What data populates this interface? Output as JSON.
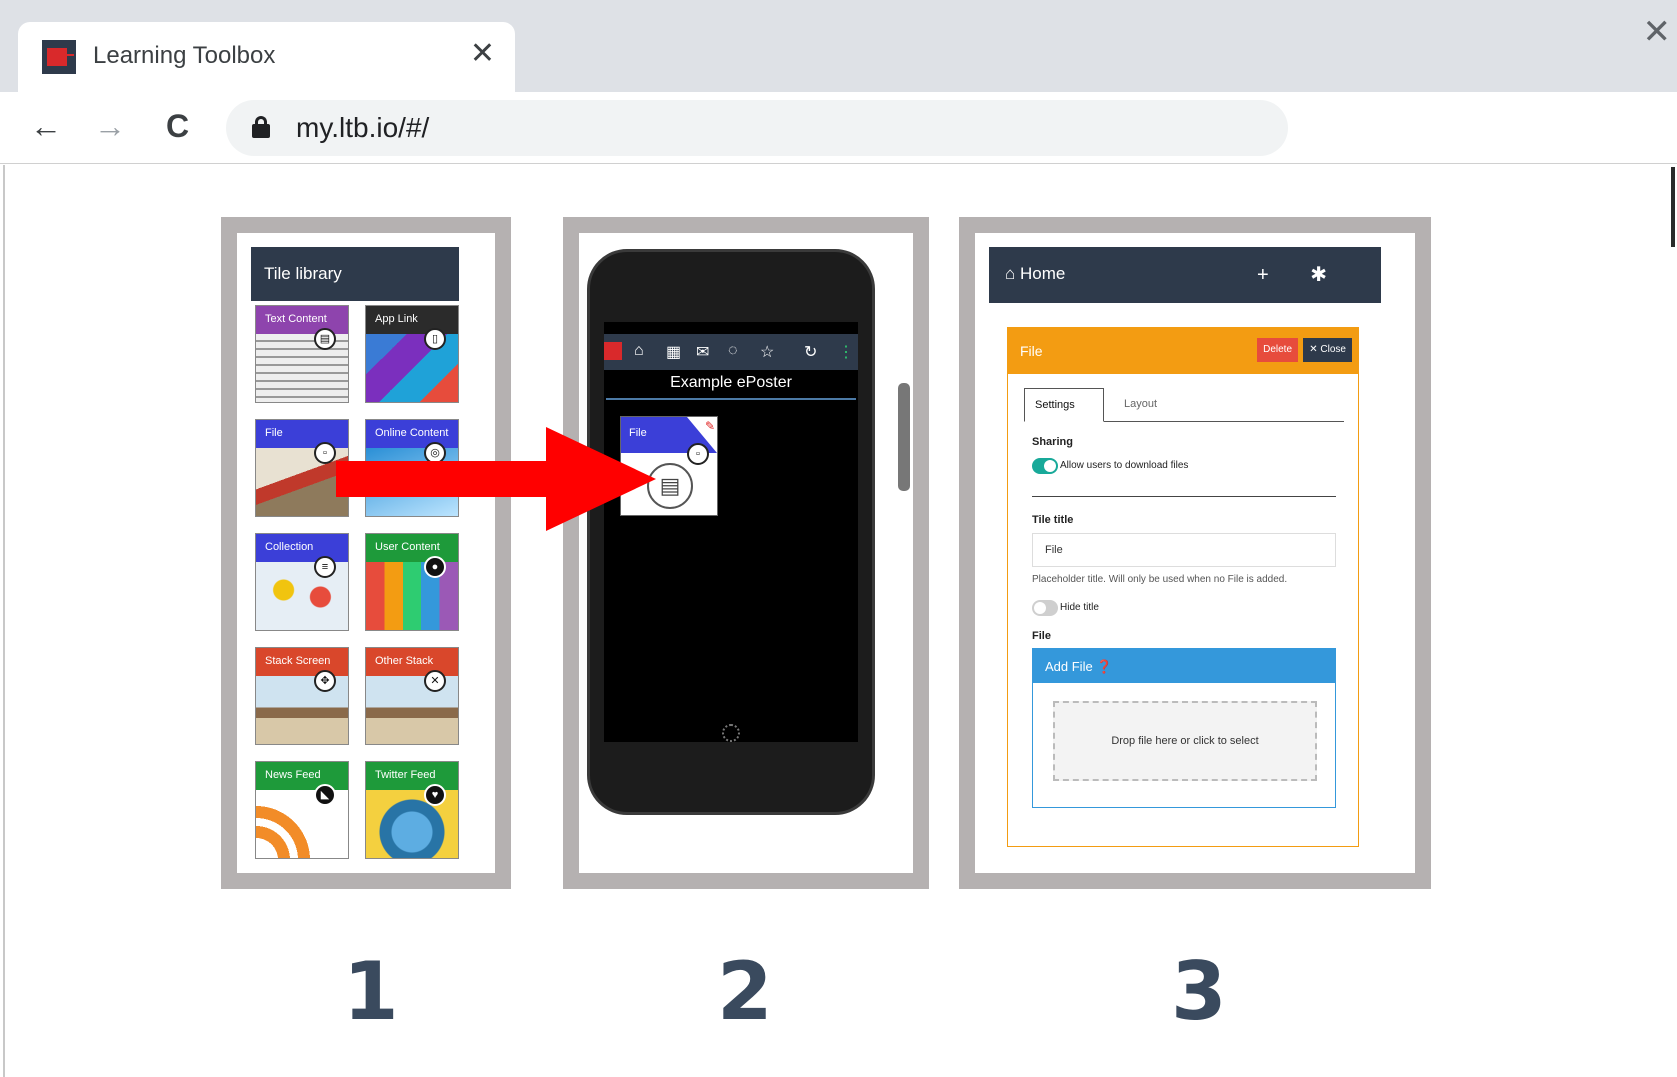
{
  "browser": {
    "tab_title": "Learning Toolbox",
    "tab_close": "✕",
    "window_close": "✕",
    "back": "←",
    "forward": "→",
    "reload": "C",
    "url": "my.ltb.io/#/"
  },
  "panel1": {
    "header": "Tile library",
    "tiles": [
      {
        "label": "Text Content",
        "color": "#8e44ad",
        "icon": "document-icon"
      },
      {
        "label": "App Link",
        "color": "#2b2b2b",
        "icon": "phone-icon"
      },
      {
        "label": "File",
        "color": "#3b3fd8",
        "icon": "file-icon"
      },
      {
        "label": "Online Content",
        "color": "#3b3fd8",
        "icon": "globe-icon"
      },
      {
        "label": "Collection",
        "color": "#3b3fd8",
        "icon": "list-icon"
      },
      {
        "label": "User Content",
        "color": "#1e9a3a",
        "icon": "user-icon"
      },
      {
        "label": "Stack Screen",
        "color": "#d9472b",
        "icon": "move-icon"
      },
      {
        "label": "Other Stack",
        "color": "#d9472b",
        "icon": "expand-icon"
      },
      {
        "label": "News Feed",
        "color": "#1e9a3a",
        "icon": "rss-icon"
      },
      {
        "label": "Twitter Feed",
        "color": "#1e9a3a",
        "icon": "twitter-icon"
      }
    ]
  },
  "panel2": {
    "poster_title": "Example ePoster",
    "file_tile_label": "File"
  },
  "panel3": {
    "home_label": "⌂ Home",
    "home_actions": "+ ✱",
    "card_title": "File",
    "delete_label": "Delete",
    "close_label": "✕ Close",
    "tab_settings": "Settings",
    "tab_layout": "Layout",
    "sharing_label": "Sharing",
    "allow_download": "Allow users to download files",
    "tile_title_label": "Tile title",
    "tile_title_value": "File",
    "placeholder_hint": "Placeholder title. Will only be used when no File is added.",
    "hide_title": "Hide title",
    "file_label": "File",
    "add_file": "Add File",
    "drop_hint": "Drop file here or click to select"
  },
  "steps": [
    "1",
    "2",
    "3"
  ],
  "colors": {
    "accent_dark": "#2e3a4b",
    "orange": "#f39c12",
    "blue": "#3498db",
    "arrow": "#ff0000"
  }
}
